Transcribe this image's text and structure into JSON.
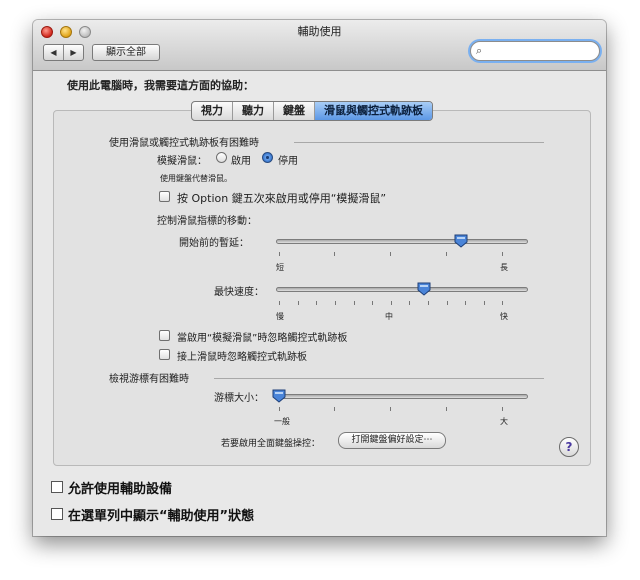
{
  "window": {
    "title": "輔助使用"
  },
  "toolbar": {
    "back": "◀",
    "forward": "▶",
    "show_all": "顯示全部",
    "search_placeholder": ""
  },
  "prompt": "使用此電腦時，我需要這方面的協助：",
  "tabs": [
    {
      "label": "視力",
      "active": false
    },
    {
      "label": "聽力",
      "active": false
    },
    {
      "label": "鍵盤",
      "active": false
    },
    {
      "label": "滑鼠與觸控式軌跡板",
      "active": true
    }
  ],
  "mouse_section": {
    "title": "使用滑鼠或觸控式軌跡板有困難時",
    "mouse_keys_label": "模擬滑鼠：",
    "on_label": "啟用",
    "off_label": "停用",
    "selected": "停用",
    "hint": "使用鍵盤代替滑鼠。",
    "option_toggle_label": "按 Option 鍵五次來啟用或停用“模擬滑鼠”",
    "pointer_movement_label": "控制滑鼠指標的移動：",
    "initial_delay": {
      "label": "開始前的暫延：",
      "min": "短",
      "max": "長",
      "value": 0.74
    },
    "max_speed": {
      "label": "最快速度：",
      "min": "慢",
      "mid": "中",
      "max": "快",
      "value": 0.59
    },
    "ignore_trackpad_label": "當啟用“模擬滑鼠”時忽略觸控式軌跡板",
    "ignore_when_mouse_label": "接上滑鼠時忽略觸控式軌跡板"
  },
  "cursor_section": {
    "title": "檢視游標有困難時",
    "cursor_size": {
      "label": "游標大小：",
      "min": "一般",
      "max": "大",
      "value": 0.0
    }
  },
  "keyboard_access": {
    "label": "若要啟用全面鍵盤操控：",
    "button": "打開鍵盤偏好設定⋯"
  },
  "help": "?",
  "bottom": {
    "assistive_devices": "允許使用輔助設備",
    "menu_status": "在選單列中顯示“輔助使用”狀態"
  }
}
